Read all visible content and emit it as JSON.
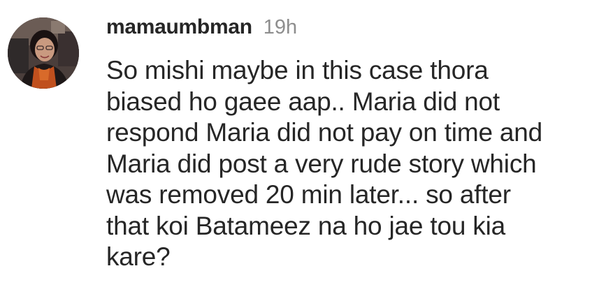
{
  "comment": {
    "username": "mamaumbman",
    "timestamp": "19h",
    "avatar_icon": "profile-photo-avatar",
    "text_lines": [
      "So mishi maybe in this case thora",
      "biased ho gaee aap.. Maria did not",
      "respond Maria did not pay on time and",
      "Maria did post a very rude story which",
      "was removed 20 min later... so after",
      "that koi Batameez na ho jae tou kia",
      "kare?"
    ]
  },
  "colors": {
    "text": "#262626",
    "muted": "#8e8e8e",
    "background": "#ffffff"
  }
}
